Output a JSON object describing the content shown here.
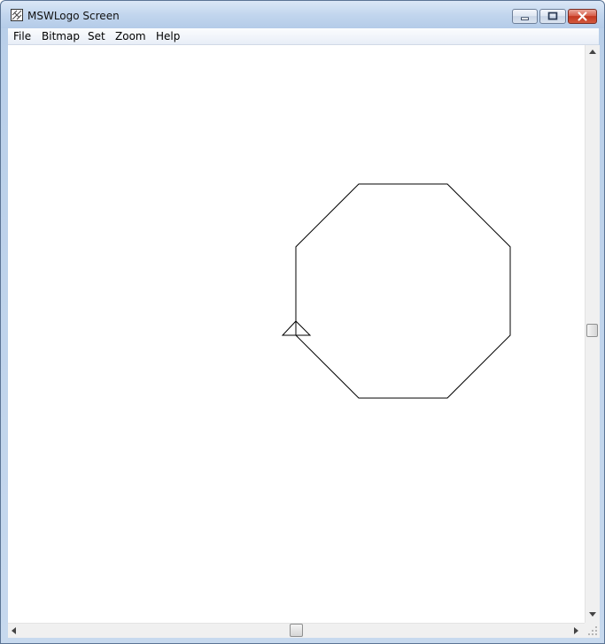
{
  "window": {
    "title": "MSWLogo Screen",
    "icon": "mswlogo-app-icon"
  },
  "title_buttons": {
    "minimize_icon": "minimize-icon",
    "maximize_icon": "maximize-icon",
    "close_icon": "close-icon",
    "close_color": "#c3371f"
  },
  "menu": {
    "items": [
      "File",
      "Bitmap",
      "Set",
      "Zoom",
      "Help"
    ]
  },
  "drawing": {
    "shape": "octagon",
    "stroke_color": "#000000",
    "turtle_icon": "turtle-triangle-icon"
  },
  "scrollbars": {
    "vertical_up_icon": "arrow-up-icon",
    "vertical_down_icon": "arrow-down-icon",
    "horizontal_left_icon": "arrow-left-icon",
    "horizontal_right_icon": "arrow-right-icon"
  }
}
